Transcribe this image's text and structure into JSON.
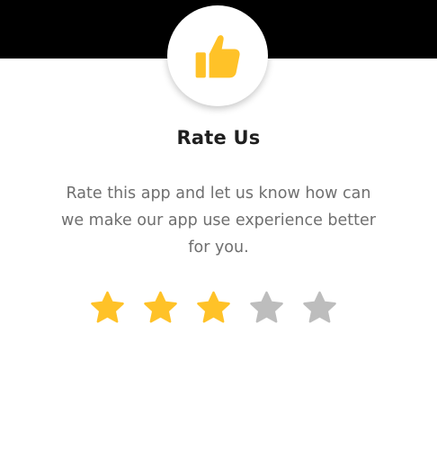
{
  "dialog": {
    "title": "Rate Us",
    "description": "Rate this app and let us know how can we make our app use experience better for you.",
    "icon": "thumbs-up-icon"
  },
  "rating": {
    "value": 3,
    "max": 5,
    "star_icon": "star-icon",
    "filled_color": "#FFC228",
    "empty_color": "#BDBDBD"
  },
  "colors": {
    "backdrop": "#000000",
    "card": "#FFFFFF",
    "accent": "#FFC228"
  }
}
